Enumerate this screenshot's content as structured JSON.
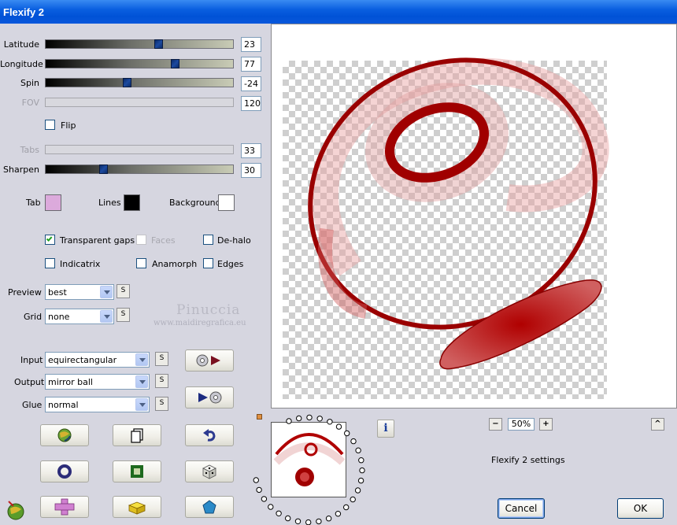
{
  "window": {
    "title": "Flexify 2"
  },
  "sliders": [
    {
      "label": "Latitude",
      "value": "23",
      "fraction": 0.61,
      "enabled": true
    },
    {
      "label": "Longitude",
      "value": "77",
      "fraction": 0.7,
      "enabled": true
    },
    {
      "label": "Spin",
      "value": "-24",
      "fraction": 0.43,
      "enabled": true
    },
    {
      "label": "FOV",
      "value": "120",
      "fraction": 0.0,
      "enabled": false
    },
    {
      "label": "Tabs",
      "value": "33",
      "fraction": 0.0,
      "enabled": false
    },
    {
      "label": "Sharpen",
      "value": "30",
      "fraction": 0.3,
      "enabled": true
    }
  ],
  "flip": {
    "label": "Flip",
    "checked": false
  },
  "colors": {
    "tab": {
      "label": "Tab",
      "color": "#dcaadc"
    },
    "lines": {
      "label": "Lines",
      "color": "#000000"
    },
    "background": {
      "label": "Background",
      "color": "#ffffff"
    }
  },
  "options": {
    "transparent_gaps": {
      "label": "Transparent gaps",
      "checked": true
    },
    "faces": {
      "label": "Faces",
      "checked": false,
      "enabled": false
    },
    "de_halo": {
      "label": "De-halo",
      "checked": false
    },
    "indicatrix": {
      "label": "Indicatrix",
      "checked": false
    },
    "anamorph": {
      "label": "Anamorph",
      "checked": false
    },
    "edges": {
      "label": "Edges",
      "checked": false
    }
  },
  "preview_select": {
    "label": "Preview",
    "value": "best"
  },
  "grid_select": {
    "label": "Grid",
    "value": "none"
  },
  "input_select": {
    "label": "Input",
    "value": "equirectangular"
  },
  "output_select": {
    "label": "Output",
    "value": "mirror ball"
  },
  "glue_select": {
    "label": "Glue",
    "value": "normal"
  },
  "s_label": "S",
  "watermark": {
    "name": "Pinuccia",
    "site": "www.maidiregrafica.eu"
  },
  "zoom": {
    "value": "50%",
    "minus": "−",
    "plus": "+"
  },
  "up_label": "^",
  "info_label": "i",
  "status_text": "Flexify 2 settings",
  "cancel_label": "Cancel",
  "ok_label": "OK",
  "accent": {
    "preview_shape": "#a00000",
    "title_bar": "#0a5fe0"
  }
}
